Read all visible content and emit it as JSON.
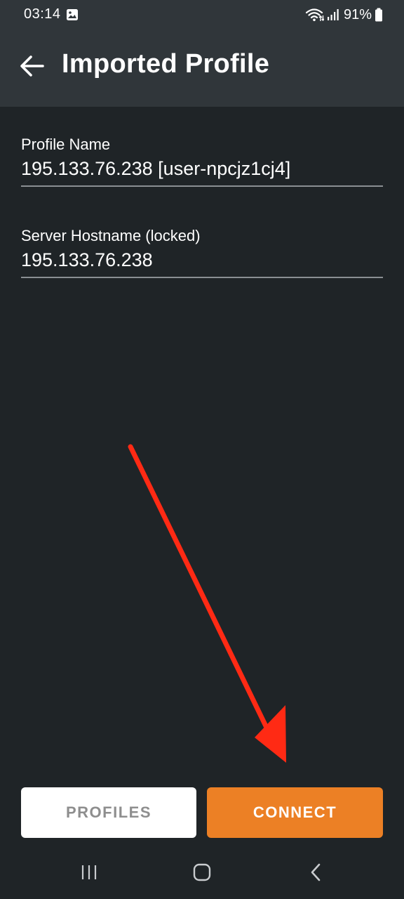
{
  "status_bar": {
    "time": "03:14",
    "battery_percent": "91%",
    "icons": [
      "gallery-icon",
      "wifi-icon",
      "signal-icon",
      "battery-icon"
    ]
  },
  "app_bar": {
    "title": "Imported Profile",
    "back_icon": "arrow-left-icon"
  },
  "form": {
    "profile_name": {
      "label": "Profile Name",
      "value": "195.133.76.238 [user-npcjz1cj4]"
    },
    "server_hostname": {
      "label": "Server Hostname (locked)",
      "value": "195.133.76.238"
    }
  },
  "buttons": {
    "profiles_label": "PROFILES",
    "connect_label": "CONNECT"
  },
  "annotation": {
    "arrow_color": "#ff2a14",
    "points_to": "connect-button"
  },
  "nav_bar": {
    "icons": [
      "recents-icon",
      "home-icon",
      "back-icon"
    ]
  },
  "colors": {
    "background": "#1f2427",
    "header": "#30363a",
    "accent": "#ec8025",
    "underline": "#8a8f93"
  }
}
